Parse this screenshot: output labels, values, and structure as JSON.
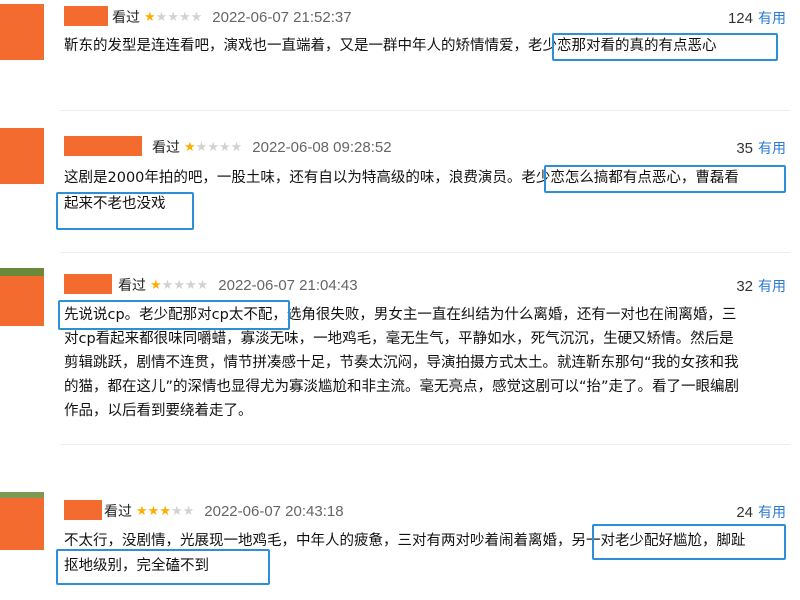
{
  "accent_blue": "#2d8fd6",
  "star_color": "#ffad00",
  "reviews": [
    {
      "status": "看过",
      "rating": 1,
      "date": "2022-06-07 21:52:37",
      "useful_count": "124",
      "useful_label": "有用",
      "lines": [
        "靳东的发型是连连看吧，演戏也一直端着，又是一群中年人的矫情情爱，老少恋那对看的真的有点恶心"
      ]
    },
    {
      "status": "看过",
      "rating": 1,
      "date": "2022-06-08 09:28:52",
      "useful_count": "35",
      "useful_label": "有用",
      "lines": [
        "这剧是2000年拍的吧，一股土味，还有自以为特高级的味，浪费演员。老少恋怎么搞都有点恶心，曹磊看",
        "起来不老也没戏"
      ]
    },
    {
      "status": "看过",
      "rating": 1,
      "date": "2022-06-07 21:04:43",
      "useful_count": "32",
      "useful_label": "有用",
      "lines": [
        "先说说cp。老少配那对cp太不配，选角很失败，男女主一直在纠结为什么离婚，还有一对也在闹离婚，三",
        "对cp看起来都很味同嚼蜡，寡淡无味，一地鸡毛，毫无生气，平静如水，死气沉沉，生硬又矫情。然后是",
        "剪辑跳跃，剧情不连贯，情节拼凑感十足，节奏太沉闷，导演拍摄方式太土。就连靳东那句“我的女孩和我",
        "的猫，都在这儿”的深情也显得尤为寡淡尴尬和非主流。毫无亮点，感觉这剧可以“抬”走了。看了一眼编剧",
        "作品，以后看到要绕着走了。"
      ]
    },
    {
      "status": "看过",
      "rating": 3,
      "date": "2022-06-07 20:43:18",
      "useful_count": "24",
      "useful_label": "有用",
      "lines": [
        "不太行，没剧情，光展现一地鸡毛，中年人的疲惫，三对有两对吵着闹着离婚，另一对老少配好尴尬，脚趾",
        "抠地级别，完全磕不到"
      ]
    }
  ]
}
